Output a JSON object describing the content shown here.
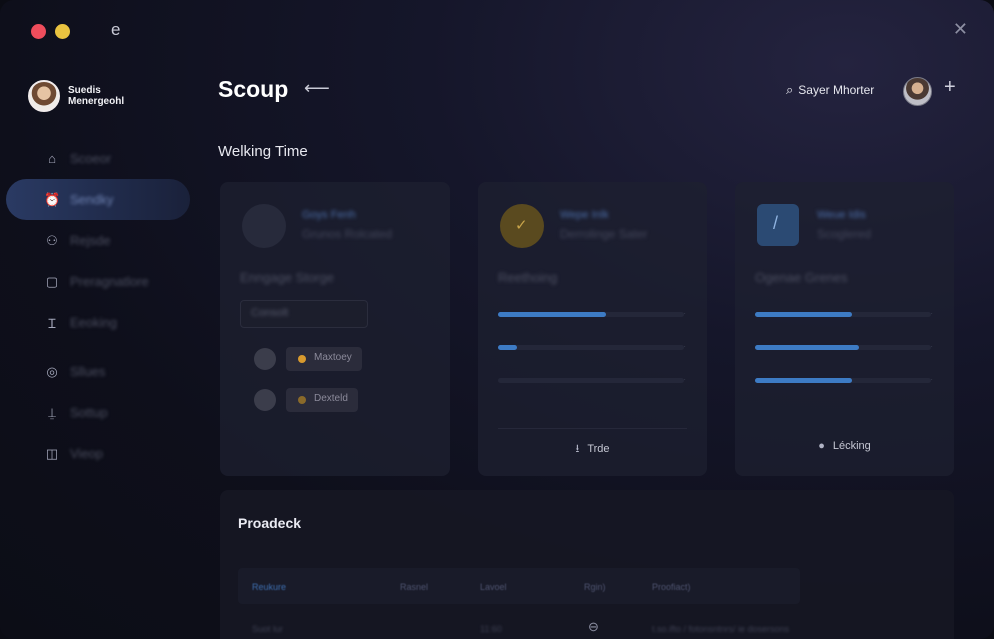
{
  "window": {
    "title_glyph": "e",
    "close_glyph": "✕"
  },
  "sidebar": {
    "profile": {
      "line1": "Suedis",
      "line2": "Menergeohl"
    },
    "items": [
      {
        "label": "Scoeor",
        "icon": "home-icon",
        "glyph": "⌂"
      },
      {
        "label": "Sendky",
        "icon": "alarm-clock-icon",
        "glyph": "⏰"
      },
      {
        "label": "Rejsde",
        "icon": "user-icon",
        "glyph": "⚇"
      },
      {
        "label": "Preragnatlore",
        "icon": "square-icon",
        "glyph": "▢"
      },
      {
        "label": "Eeoking",
        "icon": "bracket-icon",
        "glyph": "Ɪ"
      },
      {
        "label": "Sllues",
        "icon": "circle-icon",
        "glyph": "◎"
      },
      {
        "label": "Sottup",
        "icon": "chart-icon",
        "glyph": "⍊"
      },
      {
        "label": "Vieop",
        "icon": "chat-icon",
        "glyph": "◫"
      }
    ]
  },
  "header": {
    "title": "Scoup",
    "back_glyph": "⟵",
    "search_label": "Sayer Mhorter",
    "search_glyph": "⌕",
    "plus_glyph": "+"
  },
  "section_title": "Welking Time",
  "cards": [
    {
      "head1": "Goys Fenh",
      "head2": "Grunos Rolcated",
      "subtitle": "Enngage Storge",
      "input_value": "Consolt",
      "rows": [
        {
          "pill": "Maxtoey"
        },
        {
          "pill": "Dexteld"
        }
      ]
    },
    {
      "head1": "Wepe Inlk",
      "head2": "Derrolinge Sater",
      "subtitle": "Reethoing",
      "bars": [
        0.58,
        0.1,
        0.0
      ],
      "footer": "Trde",
      "footer_icon": "download-icon",
      "footer_glyph": "⭳"
    },
    {
      "head1": "Weue Idis",
      "head2": "Scoglered",
      "subtitle": "Ogenae Grenes",
      "bars": [
        0.55,
        0.59,
        0.55
      ],
      "footer": "Lécking",
      "footer_icon": "dot-icon",
      "footer_glyph": "●"
    }
  ],
  "table": {
    "title": "Proadeck",
    "columns": [
      "Reukure",
      "Rasnel",
      "Lavoel",
      "Rgin)",
      "Proofiact)"
    ],
    "row": [
      "Suot lur",
      "11:60",
      "",
      "⊖",
      "t.so.ifto / fotonsntnrs/ ie dosersons"
    ]
  },
  "colors": {
    "accent": "#3d7bc4",
    "red_dot": "#ee4d5c",
    "yellow_dot": "#e9c340",
    "gold": "#d89a2e"
  }
}
